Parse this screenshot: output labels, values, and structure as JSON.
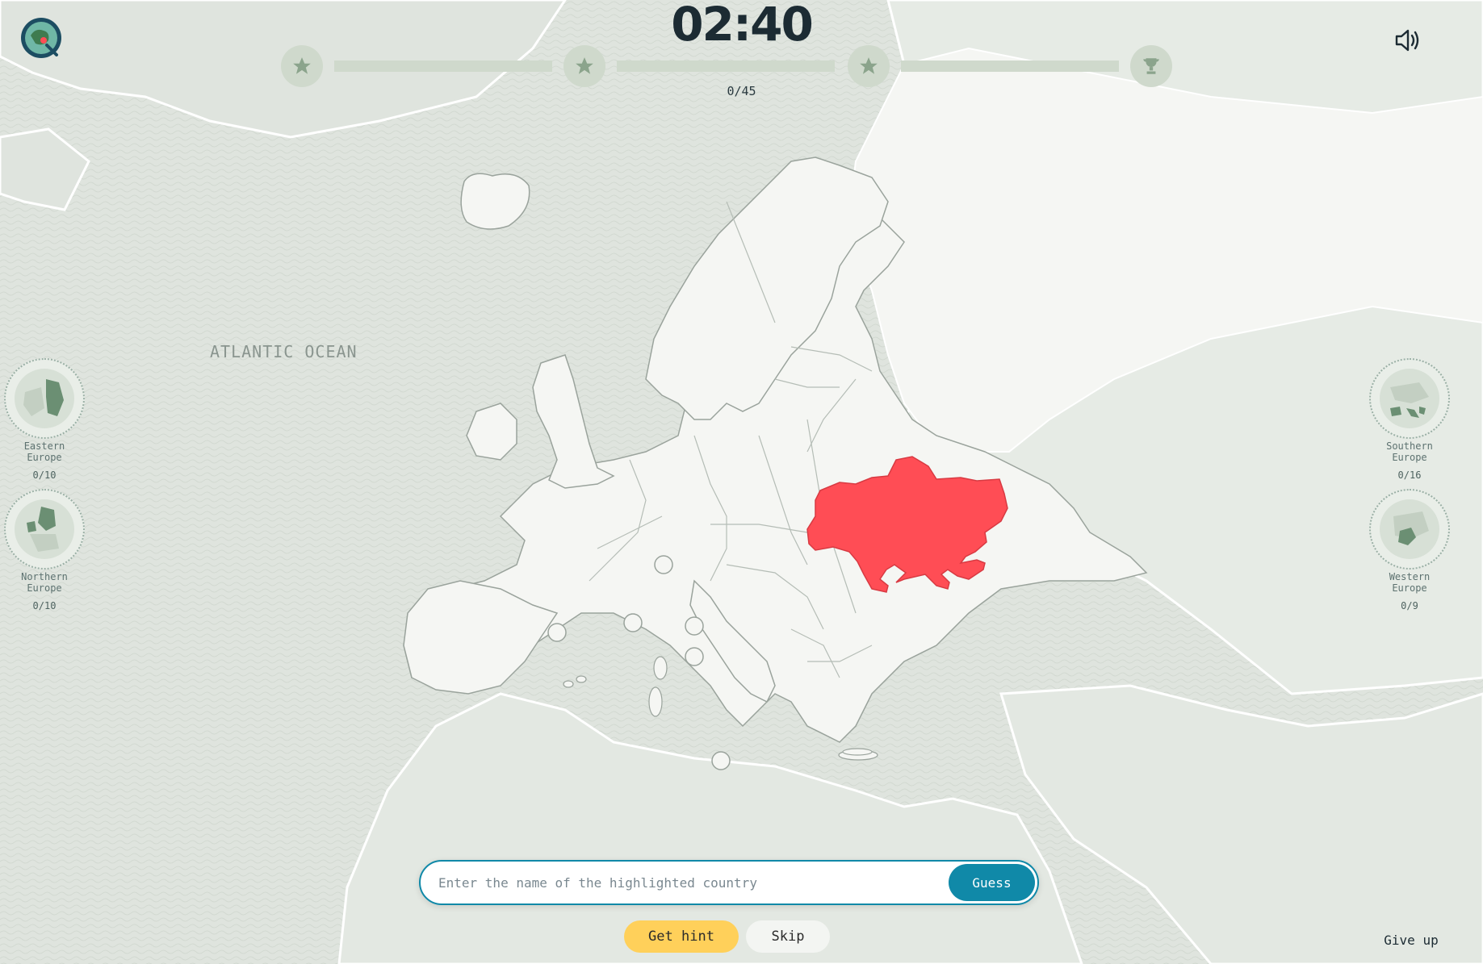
{
  "timer": "02:40",
  "progress": {
    "count": "0/45",
    "fraction": 0.0,
    "milestones": [
      "star-icon",
      "star-icon",
      "star-icon",
      "trophy-icon"
    ]
  },
  "ocean_label": "ATLANTIC OCEAN",
  "regions": [
    {
      "name": "Eastern\nEurope",
      "count": "0/10"
    },
    {
      "name": "Northern\nEurope",
      "count": "0/10"
    },
    {
      "name": "Southern\nEurope",
      "count": "0/16"
    },
    {
      "name": "Western\nEurope",
      "count": "0/9"
    }
  ],
  "input": {
    "placeholder": "Enter the name of the highlighted country",
    "value": ""
  },
  "buttons": {
    "guess": "Guess",
    "hint": "Get hint",
    "skip": "Skip",
    "give_up": "Give up"
  },
  "colors": {
    "highlight": "#ff4d55",
    "accent": "#1089a8",
    "hint": "#ffd05a",
    "land": "#f5f6f3",
    "sea": "#dfe4de"
  }
}
